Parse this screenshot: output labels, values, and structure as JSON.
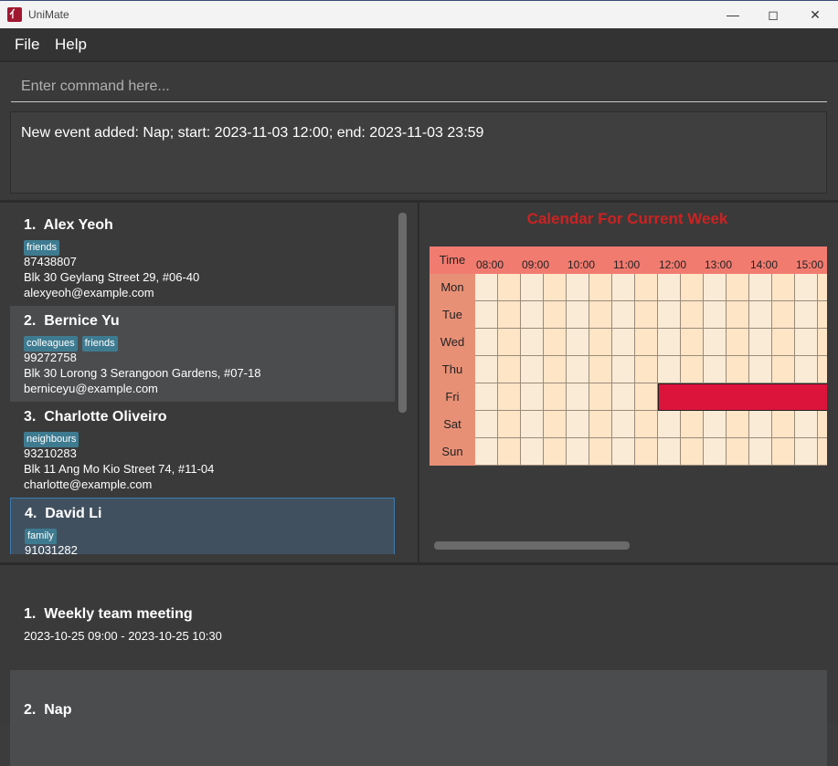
{
  "window": {
    "title": "UniMate",
    "icon_label": "亻"
  },
  "menu": {
    "items": [
      "File",
      "Help"
    ]
  },
  "command": {
    "placeholder": "Enter command here..."
  },
  "result": {
    "text": "New event added: Nap; start: 2023-11-03 12:00; end: 2023-11-03 23:59"
  },
  "persons": [
    {
      "index": "1.",
      "name": "Alex Yeoh",
      "tags": [
        "friends"
      ],
      "phone": "87438807",
      "address": "Blk 30 Geylang Street 29, #06-40",
      "email": "alexyeoh@example.com"
    },
    {
      "index": "2.",
      "name": "Bernice Yu",
      "tags": [
        "colleagues",
        "friends"
      ],
      "phone": "99272758",
      "address": "Blk 30 Lorong 3 Serangoon Gardens, #07-18",
      "email": "berniceyu@example.com"
    },
    {
      "index": "3.",
      "name": "Charlotte Oliveiro",
      "tags": [
        "neighbours"
      ],
      "phone": "93210283",
      "address": "Blk 11 Ang Mo Kio Street 74, #11-04",
      "email": "charlotte@example.com"
    },
    {
      "index": "4.",
      "name": "David Li",
      "tags": [
        "family"
      ],
      "phone": "91031282",
      "address": "",
      "email": ""
    }
  ],
  "calendar": {
    "title": "Calendar For Current Week",
    "time_label": "Time",
    "hours": [
      "08:00",
      "09:00",
      "10:00",
      "11:00",
      "12:00",
      "13:00",
      "14:00",
      "15:00"
    ],
    "days": [
      "Mon",
      "Tue",
      "Wed",
      "Thu",
      "Fri",
      "Sat",
      "Sun"
    ],
    "events": [
      {
        "day": "Fri",
        "start": "12:00",
        "end": "23:59",
        "color": "#dc143c"
      }
    ]
  },
  "events": [
    {
      "index": "1.",
      "name": "Weekly team meeting",
      "time": "2023-10-25 09:00 - 2023-10-25 10:30"
    },
    {
      "index": "2.",
      "name": "Nap",
      "time": ""
    }
  ]
}
